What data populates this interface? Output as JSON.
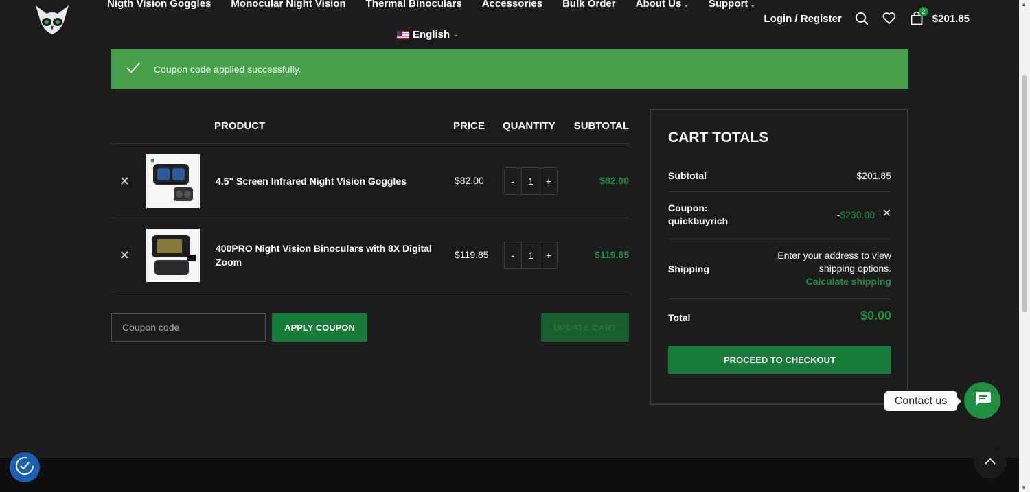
{
  "header": {
    "nav": [
      {
        "label": "Nigth Vision Goggles",
        "dropdown": false
      },
      {
        "label": "Monocular Night Vision",
        "dropdown": false
      },
      {
        "label": "Thermal Binoculars",
        "dropdown": false
      },
      {
        "label": "Accessories",
        "dropdown": false
      },
      {
        "label": "Bulk Order",
        "dropdown": false
      },
      {
        "label": "About Us",
        "dropdown": true
      },
      {
        "label": "Support",
        "dropdown": true
      }
    ],
    "language": "English",
    "login_label": "Login / Register",
    "cart_count": "2",
    "cart_total": "$201.85"
  },
  "notice": {
    "message": "Coupon code applied successfully."
  },
  "cart_table": {
    "headers": {
      "product": "PRODUCT",
      "price": "PRICE",
      "quantity": "QUANTITY",
      "subtotal": "SUBTOTAL"
    },
    "items": [
      {
        "name": "4.5\" Screen Infrared Night Vision Goggles",
        "price": "$82.00",
        "qty": "1",
        "subtotal": "$82.00"
      },
      {
        "name": "400PRO Night Vision Binoculars with 8X Digital Zoom",
        "price": "$119.85",
        "qty": "1",
        "subtotal": "$119.85"
      }
    ],
    "qty_minus": "-",
    "qty_plus": "+"
  },
  "coupon": {
    "placeholder": "Coupon code",
    "apply_label": "APPLY COUPON",
    "update_label": "UPDATE CART"
  },
  "totals": {
    "title": "CART TOTALS",
    "subtotal_label": "Subtotal",
    "subtotal_value": "$201.85",
    "coupon_label_1": "Coupon:",
    "coupon_label_2": "quickbuyrich",
    "coupon_value_prefix": "-",
    "coupon_value": "$230.00",
    "shipping_label": "Shipping",
    "shipping_text_1": "Enter your address to view",
    "shipping_text_2": "shipping options.",
    "calculate_shipping": "Calculate shipping",
    "total_label": "Total",
    "total_value": "$0.00",
    "checkout_label": "PROCEED TO CHECKOUT"
  },
  "contact": {
    "label": "Contact us"
  },
  "colors": {
    "accent": "#1e8f3e",
    "notice_bg": "#46a049",
    "page_bg": "#1c1c1c"
  }
}
